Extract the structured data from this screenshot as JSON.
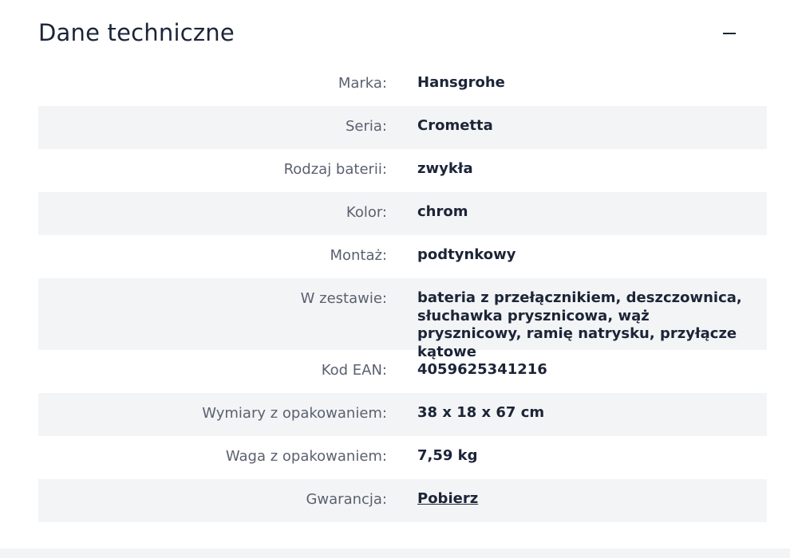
{
  "section": {
    "title": "Dane techniczne",
    "collapse_icon": "minus-icon"
  },
  "specs": [
    {
      "label": "Marka:",
      "value": "Hansgrohe"
    },
    {
      "label": "Seria:",
      "value": "Crometta"
    },
    {
      "label": "Rodzaj baterii:",
      "value": "zwykła"
    },
    {
      "label": "Kolor:",
      "value": "chrom"
    },
    {
      "label": "Montaż:",
      "value": "podtynkowy"
    },
    {
      "label": "W zestawie:",
      "value": "bateria z przełącznikiem, deszczownica, słuchawka prysznicowa, wąż prysznicowy, ramię natrysku, przyłącze kątowe"
    },
    {
      "label": "Kod EAN:",
      "value": "4059625341216"
    },
    {
      "label": "Wymiary z opakowaniem:",
      "value": "38 x 18 x 67 cm"
    },
    {
      "label": "Waga z opakowaniem:",
      "value": "7,59 kg"
    },
    {
      "label": "Gwarancja:",
      "value": "Pobierz"
    }
  ],
  "colors": {
    "text_dark": "#1c2537",
    "text_label": "#5b6170",
    "row_stripe": "#f3f4f6"
  }
}
